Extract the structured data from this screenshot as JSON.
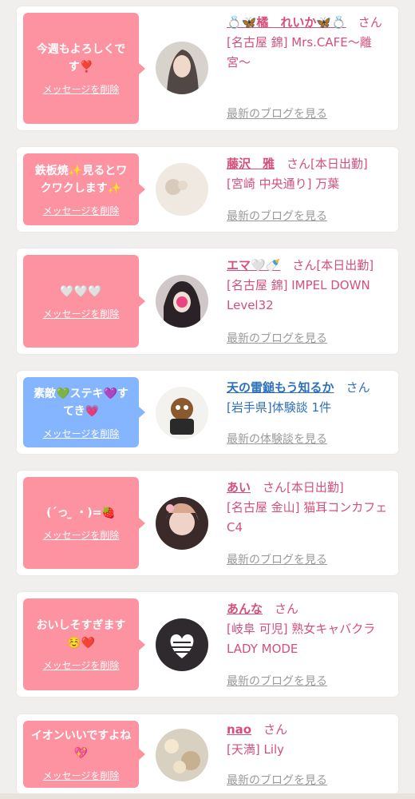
{
  "delete_label": "メッセージを削除",
  "suffix": "さん",
  "colors": {
    "pink_bubble": "#fd92a1",
    "blue_bubble": "#86b5ff",
    "name_pink": "#d64f7a",
    "name_blue": "#2d6fba",
    "link_gray": "#9a9a9a"
  },
  "items": [
    {
      "message": "今週もよろしくです❣️",
      "name": "💍🦋橘　れいか🦋💍",
      "status": "",
      "shop": "[名古屋 錦] Mrs.CAFE〜離宮〜",
      "link": "最新のブログを見る"
    },
    {
      "message": "鉄板焼✨見るとワクワクします✨",
      "name": "藤沢　雅",
      "status": "[本日出勤]",
      "shop": "[宮崎 中央通り] 万葉",
      "link": "最新のブログを見る"
    },
    {
      "message": "🤍🤍🤍",
      "name": "エマ🤍🍼",
      "status": "[本日出勤]",
      "shop": "[名古屋 錦] IMPEL DOWN Level32",
      "link": "最新のブログを見る"
    },
    {
      "message": "素敵💚ステキ💜すてき💗",
      "name": "天の雷鎚もう知るか",
      "status": "",
      "shop": "[岩手県]体験談 1件",
      "link": "最新の体験談を見る"
    },
    {
      "message": "(´っ ̫ ・)=🍓",
      "name": "あい",
      "status": "[本日出勤]",
      "shop": "[名古屋 金山] 猫耳コンカフェ C4",
      "link": "最新のブログを見る"
    },
    {
      "message": "おいしそすぎます☺️❤️",
      "name": "あんな",
      "status": "",
      "shop": "[岐阜 可児] 熟女キャバクラ LADY MODE",
      "link": "最新のブログを見る"
    },
    {
      "message": "イオンいいですよね💖",
      "name": "nao",
      "status": "",
      "shop": "[天満] Lily",
      "link": "最新のブログを見る"
    }
  ]
}
